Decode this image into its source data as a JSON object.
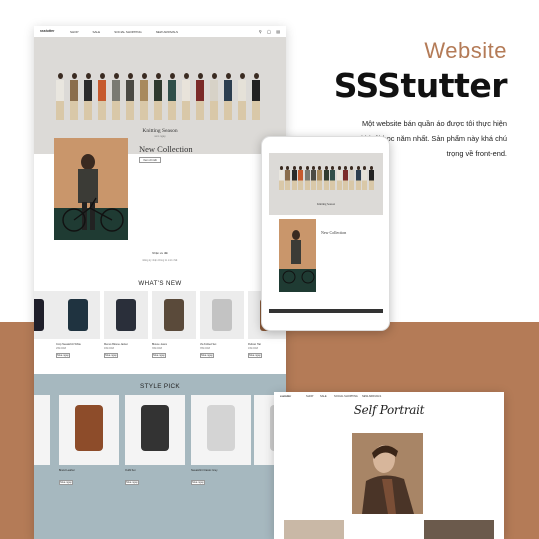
{
  "heading": {
    "eyebrow": "Website",
    "brand": "SSStutter",
    "description": "Một website bán quần áo được tôi thực hiện khi tôi học năm nhất. Sản phẩm này khá chú trọng về front-end."
  },
  "site": {
    "logo": "ssstutter",
    "nav": [
      "SHOP",
      "SALE",
      "SOCIAL SHOPPING",
      "NEW ARRIVALS"
    ],
    "hero_title": "Knitting Season",
    "hero_sub": "xem ngay",
    "new_collection": "New Collection",
    "view_btn": "Xem chi tiết",
    "mid_title": "Nhận ưu đãi",
    "mid_sub": "Đăng ký nhận thông tin mới nhất",
    "whats_new": "WHAT'S NEW",
    "style_pick": "STYLE PICK",
    "buy_btn": "Mua ngay"
  },
  "whats_new_products": [
    {
      "name": "Crop Sweatshirt White",
      "price": "299.000đ",
      "color": "#1f3340"
    },
    {
      "name": "Menus Blouse Jacket",
      "price": "499.000đ",
      "color": "#2a2f3a"
    },
    {
      "name": "Blouse Jeans",
      "price": "399.000đ",
      "color": "#5a4a3a"
    },
    {
      "name": "Jfa Knitted Set",
      "price": "359.000đ",
      "color": "#c3c3c3"
    },
    {
      "name": "Pelican Hat",
      "price": "199.000đ",
      "color": "#8b5a3a"
    }
  ],
  "style_pick_products": [
    {
      "name": "Brand Leather",
      "color": "#8d4c2a"
    },
    {
      "name": "Outfit Set",
      "color": "#333333"
    },
    {
      "name": "Sweatshirt Classic Grey",
      "color": "#d4d4d4"
    }
  ],
  "tablet": {
    "new_collection": "New Collection",
    "hero_title": "Knitting Season"
  },
  "portrait": {
    "title": "Self Portrait"
  },
  "colors": {
    "accent": "#b47b57",
    "style_pick_bg": "#a6b8bf",
    "hero_bg": "#dcdad7"
  }
}
